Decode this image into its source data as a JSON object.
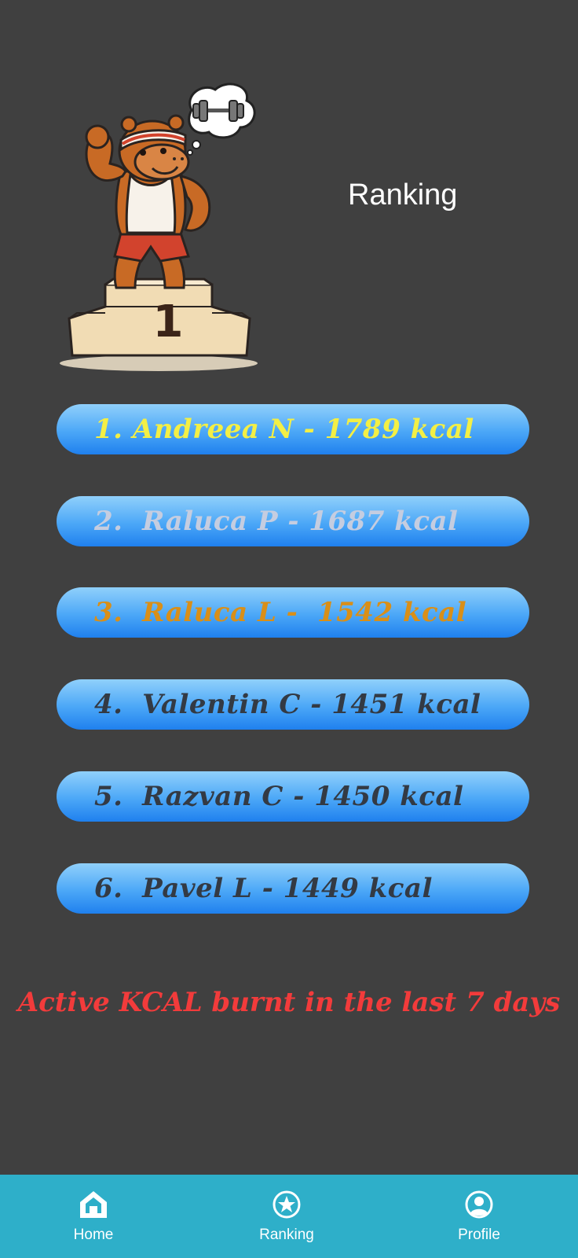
{
  "header": {
    "title": "Ranking",
    "mascot_icon": "hippo-on-podium-icon",
    "podium_number": "1"
  },
  "ranking": [
    {
      "text": "1. Andreea N - 1789 kcal",
      "color": "#f3ef45"
    },
    {
      "text": "2.  Raluca P - 1687 kcal",
      "color": "#c5cde0"
    },
    {
      "text": "3.  Raluca L -  1542 kcal",
      "color": "#d98f18"
    },
    {
      "text": "4.  Valentin C - 1451 kcal",
      "color": "#333a44"
    },
    {
      "text": "5.  Razvan C - 1450 kcal",
      "color": "#333a44"
    },
    {
      "text": "6.  Pavel L - 1449 kcal",
      "color": "#333a44"
    }
  ],
  "caption": {
    "text": "Active KCAL burnt in the last 7 days",
    "color": "#f23b3b"
  },
  "nav": [
    {
      "label": "Home",
      "icon": "home-icon"
    },
    {
      "label": "Ranking",
      "icon": "star-circle-icon"
    },
    {
      "label": "Profile",
      "icon": "account-circle-icon"
    }
  ],
  "colors": {
    "background": "#404040",
    "nav_background": "#2eafc9",
    "pill_top": "#90d0fb",
    "pill_bottom": "#1f80ee"
  }
}
